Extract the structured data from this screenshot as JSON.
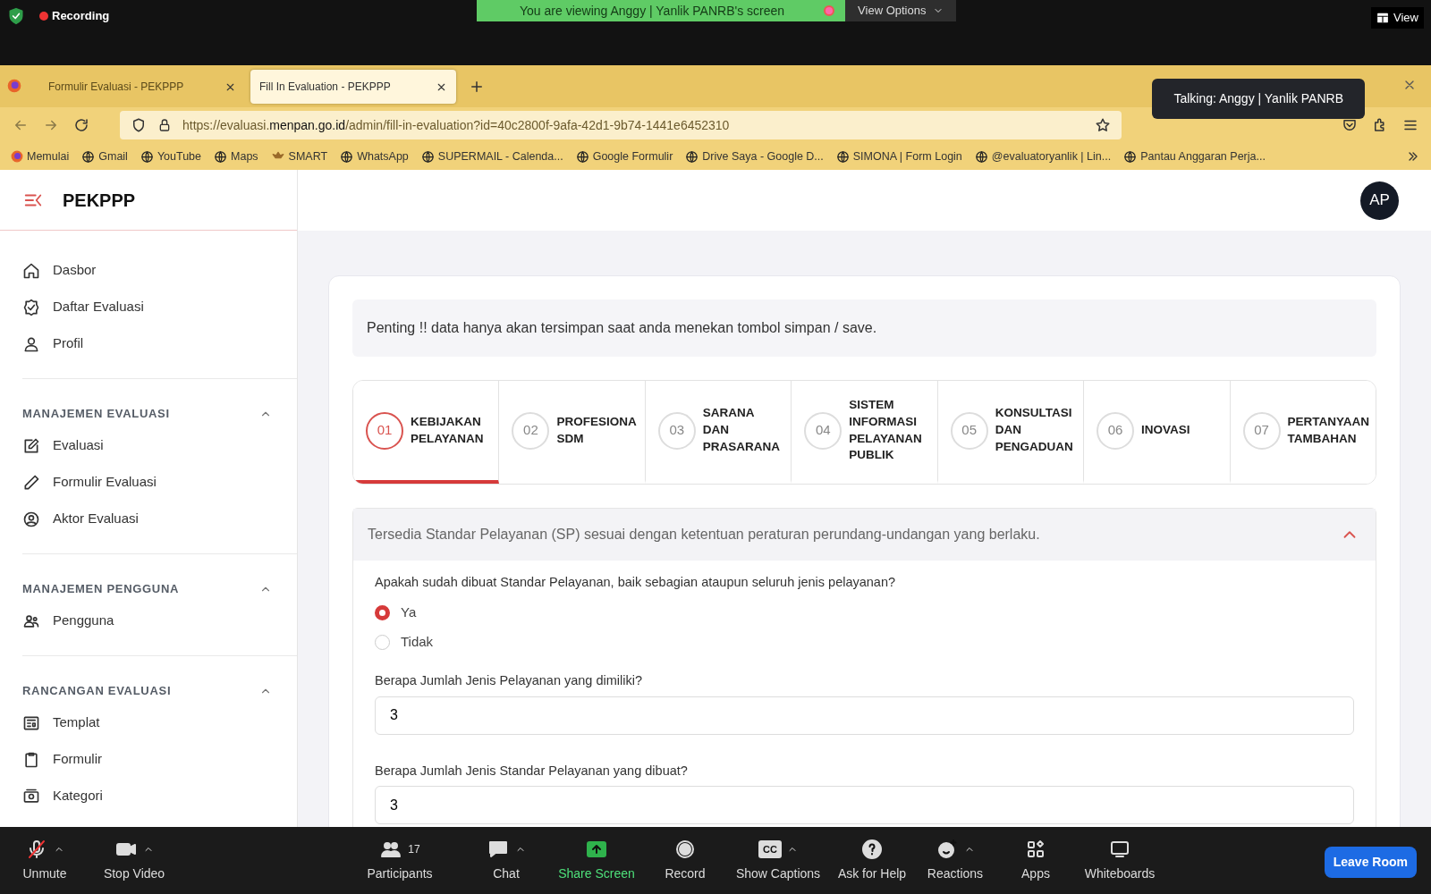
{
  "zoom_top": {
    "recording": "Recording",
    "viewing_banner": "You are viewing Anggy | Yanlik PANRB's screen",
    "view_options": "View Options",
    "view": "View"
  },
  "browser": {
    "tabs": [
      {
        "title": "Formulir Evaluasi - PEKPPP",
        "selected": false
      },
      {
        "title": "Fill In Evaluation - PEKPPP",
        "selected": true
      }
    ],
    "url_prefix": "https://evaluasi.",
    "url_domain": "menpan.go.id",
    "url_rest": "/admin/fill-in-evaluation?id=40c2800f-9afa-42d1-9b74-1441e6452310",
    "bookmarks": [
      "Memulai",
      "Gmail",
      "YouTube",
      "Maps",
      "SMART",
      "WhatsApp",
      "SUPERMAIL - Calenda...",
      "Google Formulir",
      "Drive Saya - Google D...",
      "SIMONA | Form Login",
      "@evaluatoryanlik | Lin...",
      "Pantau Anggaran Perja..."
    ]
  },
  "talking_toast": "Talking: Anggy | Yanlik PANRB",
  "app": {
    "brand": "PEKPPP",
    "avatar": "AP",
    "sidebar": {
      "items": [
        "Dasbor",
        "Daftar Evaluasi",
        "Profil"
      ],
      "sections": [
        {
          "title": "MANAJEMEN EVALUASI",
          "expanded": true,
          "items": [
            "Evaluasi",
            "Formulir Evaluasi",
            "Aktor Evaluasi"
          ]
        },
        {
          "title": "MANAJEMEN PENGGUNA",
          "expanded": true,
          "items": [
            "Pengguna"
          ]
        },
        {
          "title": "RANCANGAN EVALUASI",
          "expanded": true,
          "items": [
            "Templat",
            "Formulir",
            "Kategori"
          ]
        }
      ]
    },
    "notice": "Penting !! data hanya akan tersimpan saat anda menekan tombol simpan / save.",
    "steps": [
      {
        "number": "01",
        "label": "KEBIJAKAN\nPELAYANAN",
        "selected": true
      },
      {
        "number": "02",
        "label": "PROFESIONA\nSDM",
        "selected": false
      },
      {
        "number": "03",
        "label": "SARANA\nDAN\nPRASARANA",
        "selected": false
      },
      {
        "number": "04",
        "label": "SISTEM\nINFORMASI\nPELAYANAN\nPUBLIK",
        "selected": false
      },
      {
        "number": "05",
        "label": "KONSULTASI\nDAN\nPENGADUAN",
        "selected": false
      },
      {
        "number": "06",
        "label": "INOVASI",
        "selected": false
      },
      {
        "number": "07",
        "label": "PERTANYAAN\nTAMBAHAN",
        "selected": false
      }
    ],
    "accordion": {
      "title": "Tersedia Standar Pelayanan (SP) sesuai dengan ketentuan peraturan perundang-undangan yang berlaku.",
      "expanded": true,
      "questions": [
        {
          "kind": "radio",
          "label": "Apakah sudah dibuat Standar Pelayanan, baik sebagian ataupun seluruh jenis pelayanan?",
          "options": [
            {
              "label": "Ya",
              "selected": true
            },
            {
              "label": "Tidak",
              "selected": false
            }
          ]
        },
        {
          "kind": "number",
          "label": "Berapa Jumlah Jenis Pelayanan yang dimiliki?",
          "value": "3"
        },
        {
          "kind": "number",
          "label": "Berapa Jumlah Jenis Standar Pelayanan yang dibuat?",
          "value": "3"
        }
      ]
    }
  },
  "zoom_toolbar": {
    "items": [
      {
        "label": "Unmute",
        "menu": true,
        "highlighted": false
      },
      {
        "label": "Stop Video",
        "menu": true,
        "highlighted": false
      },
      {
        "label": "Participants",
        "count": "17",
        "menu": false,
        "highlighted": false
      },
      {
        "label": "Chat",
        "menu": true,
        "highlighted": false
      },
      {
        "label": "Share Screen",
        "menu": false,
        "highlighted": true
      },
      {
        "label": "Record",
        "menu": false,
        "highlighted": false
      },
      {
        "label": "Show Captions",
        "icon_text": "CC",
        "menu": true,
        "highlighted": false
      },
      {
        "label": "Ask for Help",
        "menu": false,
        "highlighted": false
      },
      {
        "label": "Reactions",
        "menu": true,
        "highlighted": false
      },
      {
        "label": "Apps",
        "menu": false,
        "highlighted": false
      },
      {
        "label": "Whiteboards",
        "menu": false,
        "highlighted": false
      }
    ],
    "leave": "Leave Room"
  }
}
